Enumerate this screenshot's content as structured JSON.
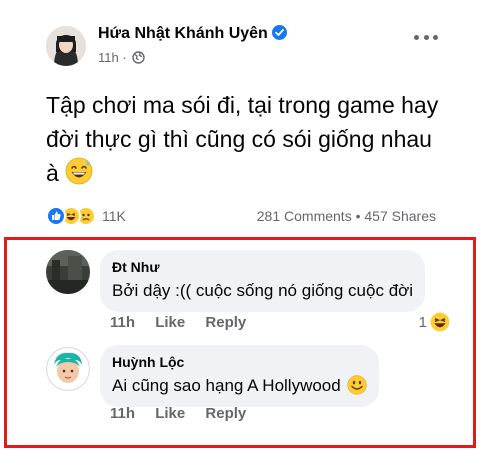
{
  "post": {
    "author": "Hứa Nhật Khánh Uyên",
    "time": "11h",
    "separator": "·",
    "text": "Tập chơi ma sói đi, tại trong game hay đời thực gì thì cũng có sói giống nhau à",
    "reactions_count": "11K",
    "comments_count": "281 Comments",
    "dot": "•",
    "shares_count": "457 Shares"
  },
  "comments": [
    {
      "name": "Đt Như",
      "text": "Bởi dậy :(( cuộc sống nó giống cuộc đời",
      "time": "11h",
      "like_label": "Like",
      "reply_label": "Reply",
      "reaction_count": "1"
    },
    {
      "name": "Huỳnh Lộc",
      "text": "Ai cũng sao hạng A Hollywood",
      "time": "11h",
      "like_label": "Like",
      "reply_label": "Reply"
    }
  ],
  "colors": {
    "accent": "#1877f2",
    "highlight_border": "#e21b1b",
    "secondary_text": "#65676b",
    "bubble_bg": "#f0f2f5"
  },
  "icons": [
    "verified-badge-icon",
    "globe-icon",
    "more-options-icon",
    "like-reaction-icon",
    "haha-reaction-icon",
    "sad-reaction-icon",
    "grinning-sweat-emoji-icon",
    "smiley-emoji-icon"
  ]
}
